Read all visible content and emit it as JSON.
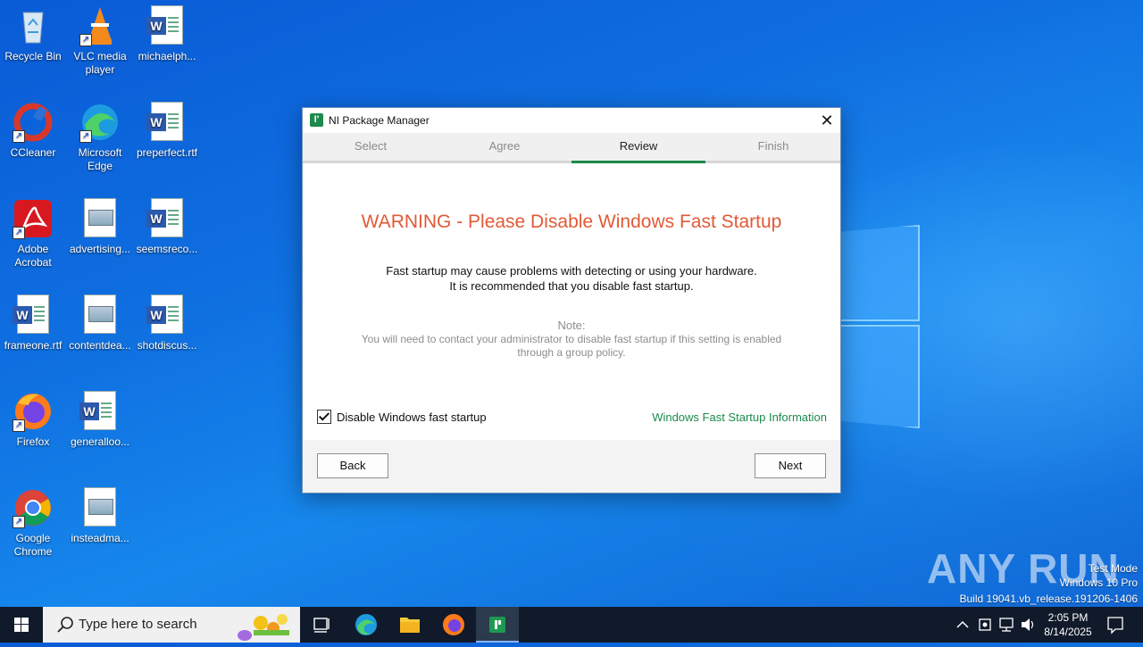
{
  "desktop": {
    "icons": [
      {
        "label": "Recycle Bin",
        "icon": "recycle-bin-icon"
      },
      {
        "label": "VLC media player",
        "icon": "vlc-icon"
      },
      {
        "label": "michaelph...",
        "icon": "word-doc-icon"
      },
      {
        "label": "CCleaner",
        "icon": "ccleaner-icon"
      },
      {
        "label": "Microsoft Edge",
        "icon": "edge-icon"
      },
      {
        "label": "preperfect.rtf",
        "icon": "word-doc-icon"
      },
      {
        "label": "Adobe Acrobat",
        "icon": "acrobat-icon"
      },
      {
        "label": "advertising...",
        "icon": "image-file-icon"
      },
      {
        "label": "seemsreco...",
        "icon": "word-doc-icon"
      },
      {
        "label": "frameone.rtf",
        "icon": "word-doc-icon"
      },
      {
        "label": "contentdea...",
        "icon": "image-file-icon"
      },
      {
        "label": "shotdiscus...",
        "icon": "word-doc-icon"
      },
      {
        "label": "Firefox",
        "icon": "firefox-icon"
      },
      {
        "label": "generalloo...",
        "icon": "word-doc-icon"
      },
      {
        "label": "Google Chrome",
        "icon": "chrome-icon"
      },
      {
        "label": "insteadma...",
        "icon": "image-file-icon"
      }
    ]
  },
  "dialog": {
    "title": "NI Package Manager",
    "steps": [
      "Select",
      "Agree",
      "Review",
      "Finish"
    ],
    "active_step": "Review",
    "warning": "WARNING - Please Disable Windows Fast Startup",
    "message_line1": "Fast startup may cause problems with detecting or using your hardware.",
    "message_line2": "It is recommended that you disable fast startup.",
    "note_label": "Note:",
    "note_text": "You will need to contact your administrator to disable fast startup if this setting is enabled through a group policy.",
    "checkbox_label": "Disable Windows fast startup",
    "checkbox_checked": true,
    "info_link": "Windows Fast Startup Information",
    "back_label": "Back",
    "next_label": "Next",
    "accent_color": "#1c8a4c",
    "warning_color": "#e05a37"
  },
  "watermark": {
    "brand": "ANY RUN",
    "mode": "Test Mode",
    "edition": "Windows 10 Pro",
    "build": "Build 19041.vb_release.191206-1406"
  },
  "taskbar": {
    "search_placeholder": "Type here to search",
    "time": "2:05 PM",
    "date": "8/14/2025"
  }
}
